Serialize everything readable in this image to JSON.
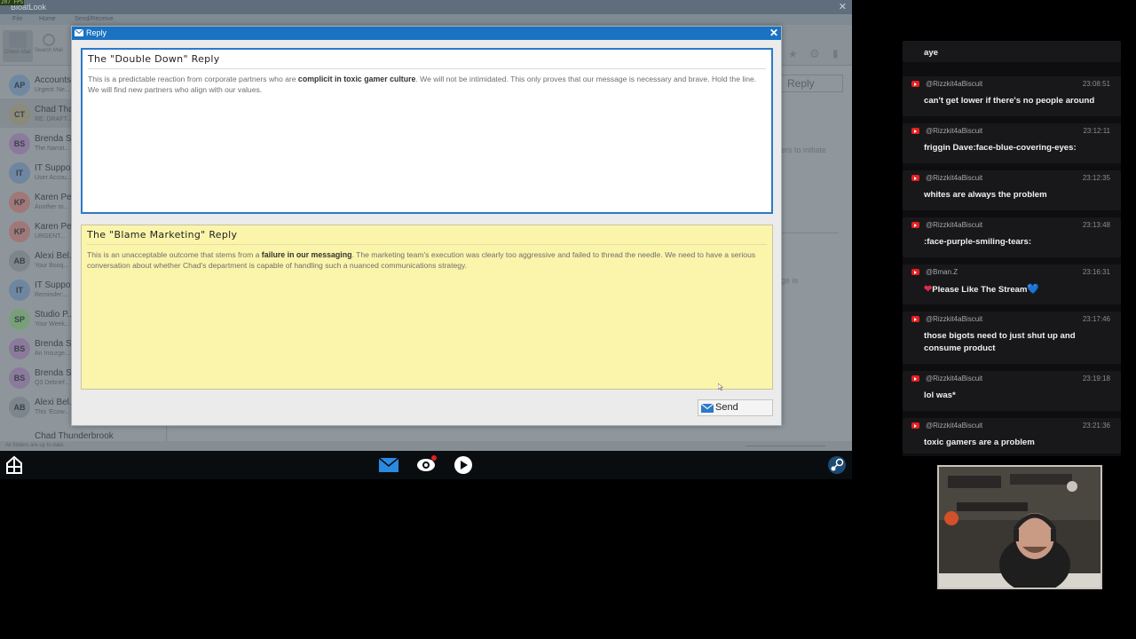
{
  "game": {
    "window_title": "BloatLook",
    "fps": "207 FPS",
    "menu": [
      "File",
      "Home",
      "Send/Receive"
    ],
    "toolbar": [
      "Check Mail",
      "Search Mail"
    ],
    "inbox": [
      {
        "initials": "AP",
        "name": "Accounts",
        "subject": "Urgent: Ne...",
        "color": "#6f89a3"
      },
      {
        "initials": "CT",
        "name": "Chad Tha...",
        "subject": "RE: DRAFT...",
        "color": "#8c8a78"
      },
      {
        "initials": "BS",
        "name": "Brenda S...",
        "subject": "The Narrat...",
        "color": "#8c7a9c"
      },
      {
        "initials": "IT",
        "name": "IT Suppo...",
        "subject": "User Accou...",
        "color": "#6e86a0"
      },
      {
        "initials": "KP",
        "name": "Karen Pe...",
        "subject": "Another ro...",
        "color": "#a07878"
      },
      {
        "initials": "KP",
        "name": "Karen Pe...",
        "subject": "URGENT...",
        "color": "#a07878"
      },
      {
        "initials": "AB",
        "name": "Alexi Bel...",
        "subject": "Your Bouq...",
        "color": "#7d858d"
      },
      {
        "initials": "IT",
        "name": "IT Suppo...",
        "subject": "Reminder:...",
        "color": "#6e86a0"
      },
      {
        "initials": "SP",
        "name": "Studio P...",
        "subject": "Your Week...",
        "color": "#78a078"
      },
      {
        "initials": "BS",
        "name": "Brenda S...",
        "subject": "An Insurge...",
        "color": "#8c7a9c"
      },
      {
        "initials": "BS",
        "name": "Brenda S...",
        "subject": "Q3 Debrief...",
        "color": "#8c7a9c"
      },
      {
        "initials": "AB",
        "name": "Alexi Bel...",
        "subject": "This 'Ecow...",
        "color": "#7d858d"
      }
    ],
    "inbox_partial": "Chad Thunderbrook",
    "status_text": "All folders are up to date.",
    "reply_button_bg": "Reply",
    "bg_text_1": "ers to initiate",
    "bg_text_2": "ge is"
  },
  "dialog": {
    "title": "Reply",
    "close": "✕",
    "option1": {
      "heading": "The \"Double Down\" Reply",
      "text_a": "This is a predictable reaction from corporate partners who are ",
      "bold": "complicit in toxic gamer culture",
      "text_b": ". We will not be intimidated. This only proves that our message is necessary and brave. Hold the line. We will find new partners who align with our values."
    },
    "option2": {
      "heading": "The \"Blame Marketing\" Reply",
      "text_a": "This is an unacceptable outcome that stems from a ",
      "bold": "failure in our messaging",
      "text_b": ". The marketing team's execution was clearly too aggressive and failed to thread the needle. We need to have a serious conversation about whether Chad's department is capable of handling such a nuanced communications strategy."
    },
    "send_label": "Send"
  },
  "chat": {
    "first_text": "aye",
    "messages": [
      {
        "user": "@Rizzkit4aBiscuit",
        "time": "23:08:51",
        "text": "can't get lower if there's no people around"
      },
      {
        "user": "@Rizzkit4aBiscuit",
        "time": "23:12:11",
        "text": "friggin Dave:face-blue-covering-eyes:"
      },
      {
        "user": "@Rizzkit4aBiscuit",
        "time": "23:12:35",
        "text": "whites are always the problem"
      },
      {
        "user": "@Rizzkit4aBiscuit",
        "time": "23:13:48",
        "text": ":face-purple-smiling-tears:"
      },
      {
        "user": "@Bman.Z",
        "time": "23:16:31",
        "text": "Please Like The Stream"
      },
      {
        "user": "@Rizzkit4aBiscuit",
        "time": "23:17:46",
        "text": "those bigots need to just shut up and consume product"
      },
      {
        "user": "@Rizzkit4aBiscuit",
        "time": "23:19:18",
        "text": "lol was*"
      },
      {
        "user": "@Rizzkit4aBiscuit",
        "time": "23:21:36",
        "text": "toxic gamers are a problem"
      }
    ],
    "heart_left": "❤",
    "heart_right": "💙"
  },
  "colors": {
    "dialog_title": "#1a72c2",
    "option1_border": "#2a7ac8",
    "option2_bg": "#fbf5ab",
    "chat_bg": "#18181b",
    "youtube_red": "#e62020"
  }
}
